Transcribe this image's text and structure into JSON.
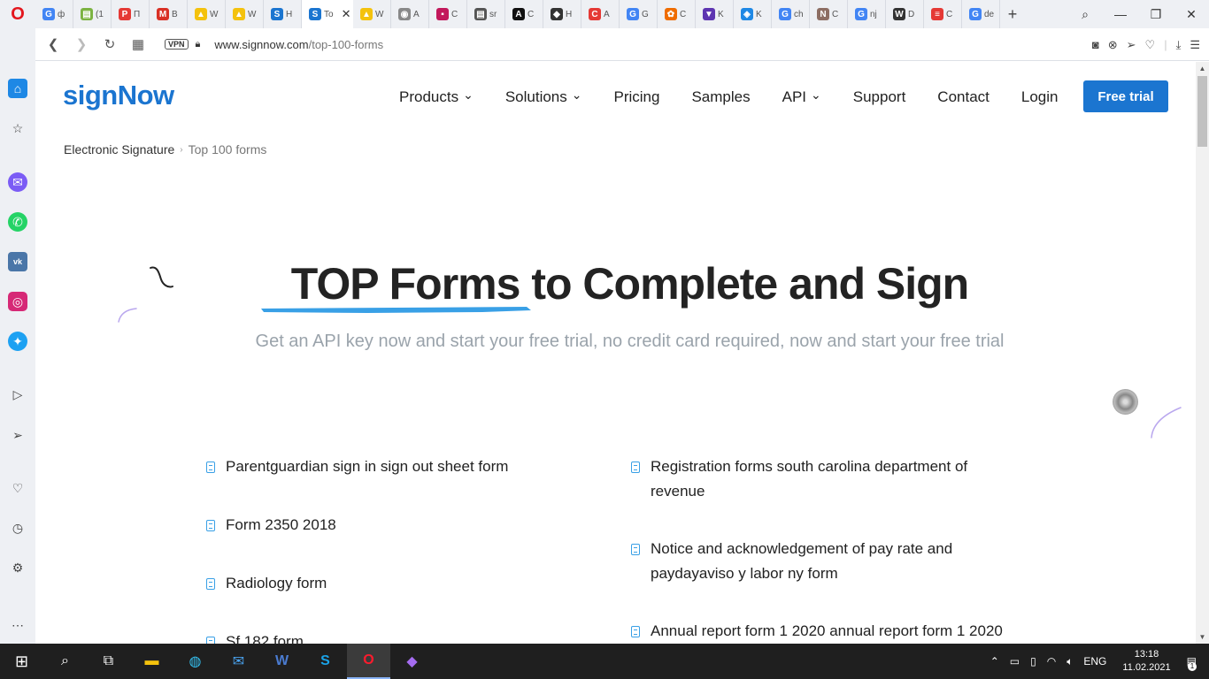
{
  "browser": {
    "tabs": [
      {
        "label": "ф",
        "icon": "G",
        "color": "#4285f4"
      },
      {
        "label": "(1",
        "icon": "▤",
        "color": "#7cb342"
      },
      {
        "label": "П",
        "icon": "P",
        "color": "#e53935"
      },
      {
        "label": "В",
        "icon": "M",
        "color": "#d93025"
      },
      {
        "label": "W",
        "icon": "▲",
        "color": "#f4c20d"
      },
      {
        "label": "W",
        "icon": "▲",
        "color": "#f4c20d"
      },
      {
        "label": "H",
        "icon": "S",
        "color": "#1b75d0"
      },
      {
        "label": "To",
        "icon": "S",
        "color": "#1b75d0",
        "active": true
      },
      {
        "label": "W",
        "icon": "▲",
        "color": "#f4c20d"
      },
      {
        "label": "A",
        "icon": "◉",
        "color": "#888"
      },
      {
        "label": "C",
        "icon": "▪",
        "color": "#c2185b"
      },
      {
        "label": "sr",
        "icon": "▤",
        "color": "#555"
      },
      {
        "label": "C",
        "icon": "A",
        "color": "#111"
      },
      {
        "label": "H",
        "icon": "◆",
        "color": "#333"
      },
      {
        "label": "A",
        "icon": "C",
        "color": "#e53935"
      },
      {
        "label": "G",
        "icon": "G",
        "color": "#4285f4"
      },
      {
        "label": "C",
        "icon": "✿",
        "color": "#ef6c00"
      },
      {
        "label": "K",
        "icon": "▼",
        "color": "#5e35b1"
      },
      {
        "label": "K",
        "icon": "◈",
        "color": "#1e88e5"
      },
      {
        "label": "ch",
        "icon": "G",
        "color": "#4285f4"
      },
      {
        "label": "C",
        "icon": "N",
        "color": "#8d6e63"
      },
      {
        "label": "nj",
        "icon": "G",
        "color": "#4285f4"
      },
      {
        "label": "D",
        "icon": "W",
        "color": "#333"
      },
      {
        "label": "C",
        "icon": "≡",
        "color": "#e53935"
      },
      {
        "label": "de",
        "icon": "G",
        "color": "#4285f4"
      }
    ],
    "active_tab_close": "✕",
    "new_tab": "+",
    "window_controls": [
      "⌕",
      "—",
      "❐",
      "✕"
    ],
    "vpn_label": "VPN",
    "url_host": "www.signnow.com",
    "url_path": "/top-100-forms"
  },
  "site": {
    "logo": "signNow",
    "nav": [
      {
        "label": "Products",
        "dropdown": true
      },
      {
        "label": "Solutions",
        "dropdown": true
      },
      {
        "label": "Pricing",
        "dropdown": false
      },
      {
        "label": "Samples",
        "dropdown": false
      },
      {
        "label": "API",
        "dropdown": true
      },
      {
        "label": "Support",
        "dropdown": false
      },
      {
        "label": "Contact",
        "dropdown": false
      },
      {
        "label": "Login",
        "dropdown": false
      }
    ],
    "cta": "Free trial",
    "breadcrumb": {
      "root": "Electronic Signature",
      "current": "Top 100 forms"
    },
    "hero_title": "TOP Forms to Complete and Sign",
    "hero_subtitle": "Get an API key now and start your free trial, no credit card required, now and start your free trial",
    "forms_left": [
      "Parentguardian sign in sign out sheet form",
      "Form 2350 2018",
      "Radiology form",
      "Sf 182 form"
    ],
    "forms_right": [
      "Registration forms south carolina department of revenue",
      "Notice and acknowledgement of pay rate and paydayaviso y labor ny form",
      "Annual report form 1 2020 annual report form 1 2020"
    ]
  },
  "taskbar": {
    "language": "ENG",
    "time": "13:18",
    "date": "11.02.2021",
    "notification_count": "1"
  }
}
